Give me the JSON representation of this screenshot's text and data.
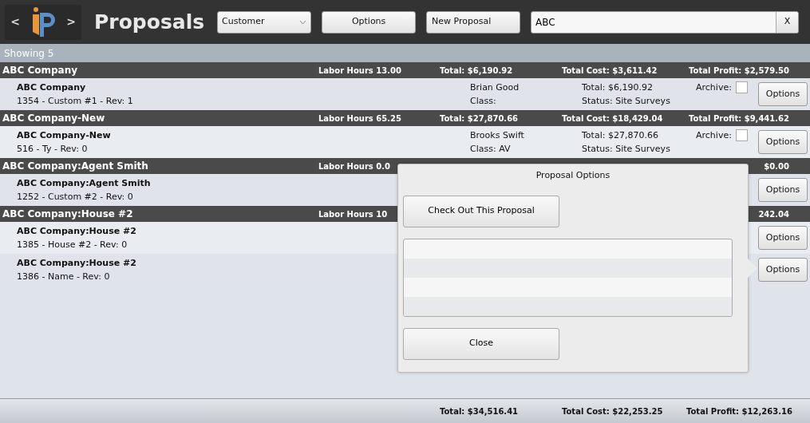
{
  "toolbar": {
    "back": "<",
    "forward": ">",
    "title": "Proposals",
    "filter": {
      "value": "Customer"
    },
    "buttons": [
      "Options",
      "New Proposal"
    ],
    "search": {
      "value": "ABC"
    },
    "clear": "X"
  },
  "showing": "Showing 5",
  "groups": [
    {
      "name": "ABC Company",
      "labor": "Labor Hours 13.00",
      "total": "Total: $6,190.92",
      "cost": "Total Cost: $3,611.42",
      "profit": "Total Profit: $2,579.50",
      "proposals": [
        {
          "name": "ABC Company",
          "detail": "1354 - Custom #1 - Rev: 1",
          "rep": "Brian Good",
          "class": "Class:",
          "total": "Total: $6,190.92",
          "status": "Status: Site Surveys",
          "archive": {
            "label": "Archive:",
            "checked": false
          },
          "button": "Options"
        }
      ]
    },
    {
      "name": "ABC Company-New",
      "labor": "Labor Hours 65.25",
      "total": "Total: $27,870.66",
      "cost": "Total Cost: $18,429.04",
      "profit": "Total Profit: $9,441.62",
      "proposals": [
        {
          "name": "ABC Company-New",
          "detail": "516 - Ty - Rev: 0",
          "rep": "Brooks Swift",
          "class": "Class: AV",
          "total": "Total: $27,870.66",
          "status": "Status: Site Surveys",
          "archive": {
            "label": "Archive:",
            "checked": false
          },
          "button": "Options"
        }
      ]
    },
    {
      "name": "ABC Company:Agent Smith",
      "labor": "Labor Hours 0.0",
      "profit": "$0.00",
      "proposals": [
        {
          "name": "ABC Company:Agent Smith",
          "detail": "1252 - Custom #2 - Rev: 0",
          "button": "Options"
        }
      ]
    },
    {
      "name": "ABC Company:House #2",
      "labor": "Labor Hours 10",
      "profit": "242.04",
      "proposals": [
        {
          "name": "ABC Company:House #2",
          "detail": "1385 - House #2 - Rev: 0",
          "button": "Options"
        },
        {
          "name": "ABC Company:House #2",
          "detail": "1386 - Name - Rev: 0",
          "button": "Options"
        }
      ]
    }
  ],
  "footer": {
    "total": "Total: $34,516.41",
    "cost": "Total Cost: $22,253.25",
    "profit": "Total Profit: $12,263.16"
  },
  "popover": {
    "title": "Proposal Options",
    "buttons": [
      "Check Out This Proposal",
      "Close"
    ]
  }
}
